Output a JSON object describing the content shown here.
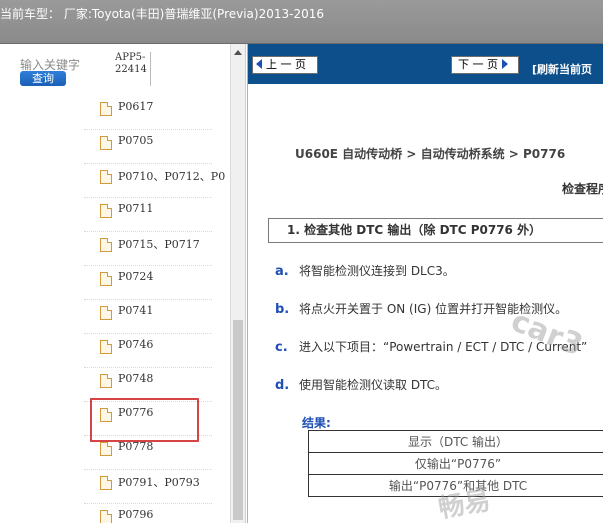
{
  "titlebar": {
    "title": "当前车型： 厂家:Toyota(丰田)普瑞维亚(Previa)2013-2016"
  },
  "search": {
    "label": "输入关键字",
    "button": "查询",
    "value": "APP5-22414"
  },
  "tree": {
    "items": [
      {
        "label": "P0617"
      },
      {
        "label": "P0705"
      },
      {
        "label": "P0710、P0712、P0"
      },
      {
        "label": "P0711"
      },
      {
        "label": "P0715、P0717"
      },
      {
        "label": "P0724"
      },
      {
        "label": "P0741"
      },
      {
        "label": "P0746"
      },
      {
        "label": "P0748"
      },
      {
        "label": "P0776"
      },
      {
        "label": "P0778"
      },
      {
        "label": "P0791、P0793"
      },
      {
        "label": "P0796"
      }
    ],
    "highlight_color": "#d64545"
  },
  "nav": {
    "prev": "上 一 页",
    "next": "下 一 页",
    "refresh": "[刷新当前页"
  },
  "doc": {
    "breadcrumb": "U660E 自动传动桥 > 自动传动桥系统 > P0776",
    "procedure_title": "检查程序",
    "step": "1. 检查其他 DTC 输出（除 DTC P0776 外）",
    "subs": [
      {
        "mark": "a.",
        "text": "将智能检测仪连接到 DLC3。"
      },
      {
        "mark": "b.",
        "text": "将点火开关置于 ON (IG) 位置并打开智能检测仪。"
      },
      {
        "mark": "c.",
        "text": "进入以下项目：“Powertrain / ECT / DTC / Current”"
      },
      {
        "mark": "d.",
        "text": "使用智能检测仪读取 DTC。"
      }
    ],
    "result_label": "结果:",
    "result_rows": [
      "显示（DTC 输出）",
      "仅输出“P0776”",
      "输出“P0776”和其他 DTC"
    ],
    "watermark_1": "car3",
    "watermark_2": "畅易"
  },
  "colors": {
    "nav_bg": "#0d4f8a",
    "accent": "#1e4fb5",
    "titlebar": "#8f8f8f"
  }
}
